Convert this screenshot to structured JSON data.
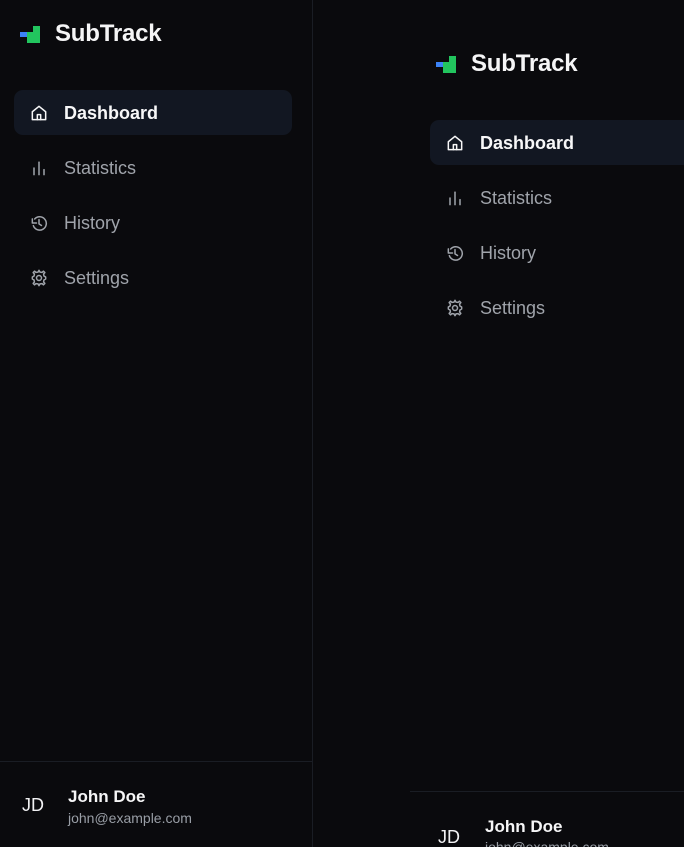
{
  "app": {
    "name": "SubTrack",
    "logo_icon": "subtrack-logo-icon"
  },
  "navigation": [
    {
      "label": "Dashboard",
      "icon": "home-icon",
      "active": true
    },
    {
      "label": "Statistics",
      "icon": "bar-chart-icon",
      "active": false
    },
    {
      "label": "History",
      "icon": "history-icon",
      "active": false
    },
    {
      "label": "Settings",
      "icon": "gear-icon",
      "active": false
    }
  ],
  "user": {
    "initials": "JD",
    "name": "John Doe",
    "email": "john@example.com"
  },
  "colors": {
    "background": "#0a0a0d",
    "active_nav_background": "#121722",
    "divider": "#1a1d24",
    "text_primary": "#f5f5f6",
    "text_secondary": "#a0a4ab",
    "logo_green": "#22c55e",
    "logo_blue": "#3b82f6"
  }
}
